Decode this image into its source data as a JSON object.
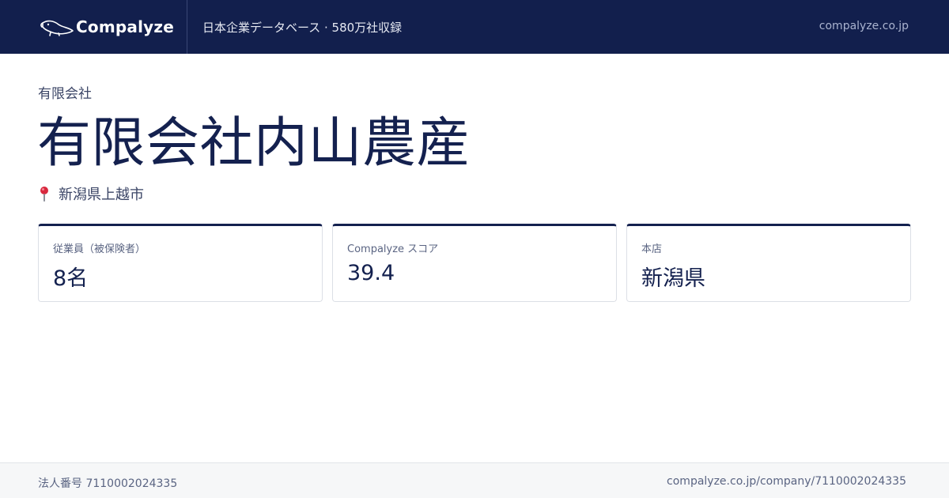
{
  "header": {
    "brand_name": "Compalyze",
    "tagline": "日本企業データベース · 580万社収録",
    "domain": "compalyze.co.jp"
  },
  "company": {
    "type": "有限会社",
    "name": "有限会社内山農産",
    "location": "新潟県上越市"
  },
  "cards": [
    {
      "label": "従業員（被保険者）",
      "value": "8名"
    },
    {
      "label": "Compalyze スコア",
      "value": "39.4"
    },
    {
      "label": "本店",
      "value": "新潟県"
    }
  ],
  "footer": {
    "corporate_number": "法人番号 7110002024335",
    "url": "compalyze.co.jp/company/7110002024335"
  },
  "colors": {
    "header_bg": "#121f4d",
    "accent": "#14214f",
    "pin": "#d9283e"
  },
  "icons": {
    "brand": "platypus-logo-icon",
    "location": "map-pin-icon"
  }
}
